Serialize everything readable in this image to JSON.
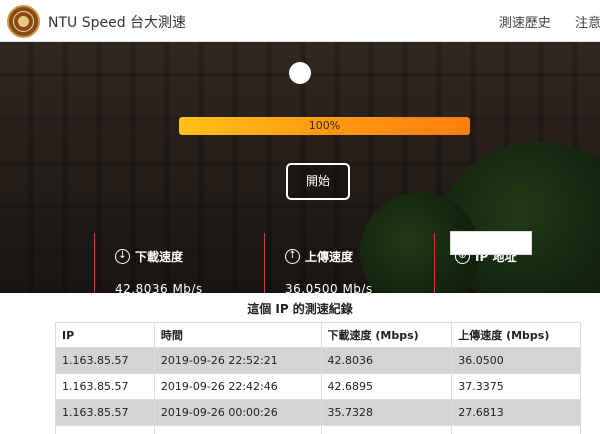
{
  "header": {
    "brand": "NTU Speed 台大測速",
    "nav": [
      "測速歷史",
      "注意事"
    ]
  },
  "test": {
    "progress_label": "100%",
    "progress_value": 1.0,
    "start_label": "開始"
  },
  "stats": {
    "download": {
      "label": "下載速度",
      "icon": "down-arrow-icon",
      "glyph": "↓",
      "value": "42.8036 Mb/s"
    },
    "upload": {
      "label": "上傳速度",
      "icon": "up-arrow-icon",
      "glyph": "↑",
      "value": "36.0500 Mb/s"
    },
    "ip": {
      "label": "IP 地址",
      "icon": "globe-icon",
      "glyph": "⊕",
      "value": ""
    }
  },
  "records": {
    "title": "這個 IP 的測速紀錄",
    "columns": [
      "IP",
      "時間",
      "下載速度 (Mbps)",
      "上傳速度 (Mbps)"
    ],
    "rows": [
      [
        "1.163.85.57",
        "2019-09-26 22:52:21",
        "42.8036",
        "36.0500"
      ],
      [
        "1.163.85.57",
        "2019-09-26 22:42:46",
        "42.6895",
        "37.3375"
      ],
      [
        "1.163.85.57",
        "2019-09-26 00:00:26",
        "35.7328",
        "27.6813"
      ],
      [
        "",
        "",
        "",
        ""
      ]
    ]
  },
  "colors": {
    "accent_line": "#d23a3a",
    "progress_start": "#ffc21a",
    "progress_end": "#ff7f0e"
  }
}
